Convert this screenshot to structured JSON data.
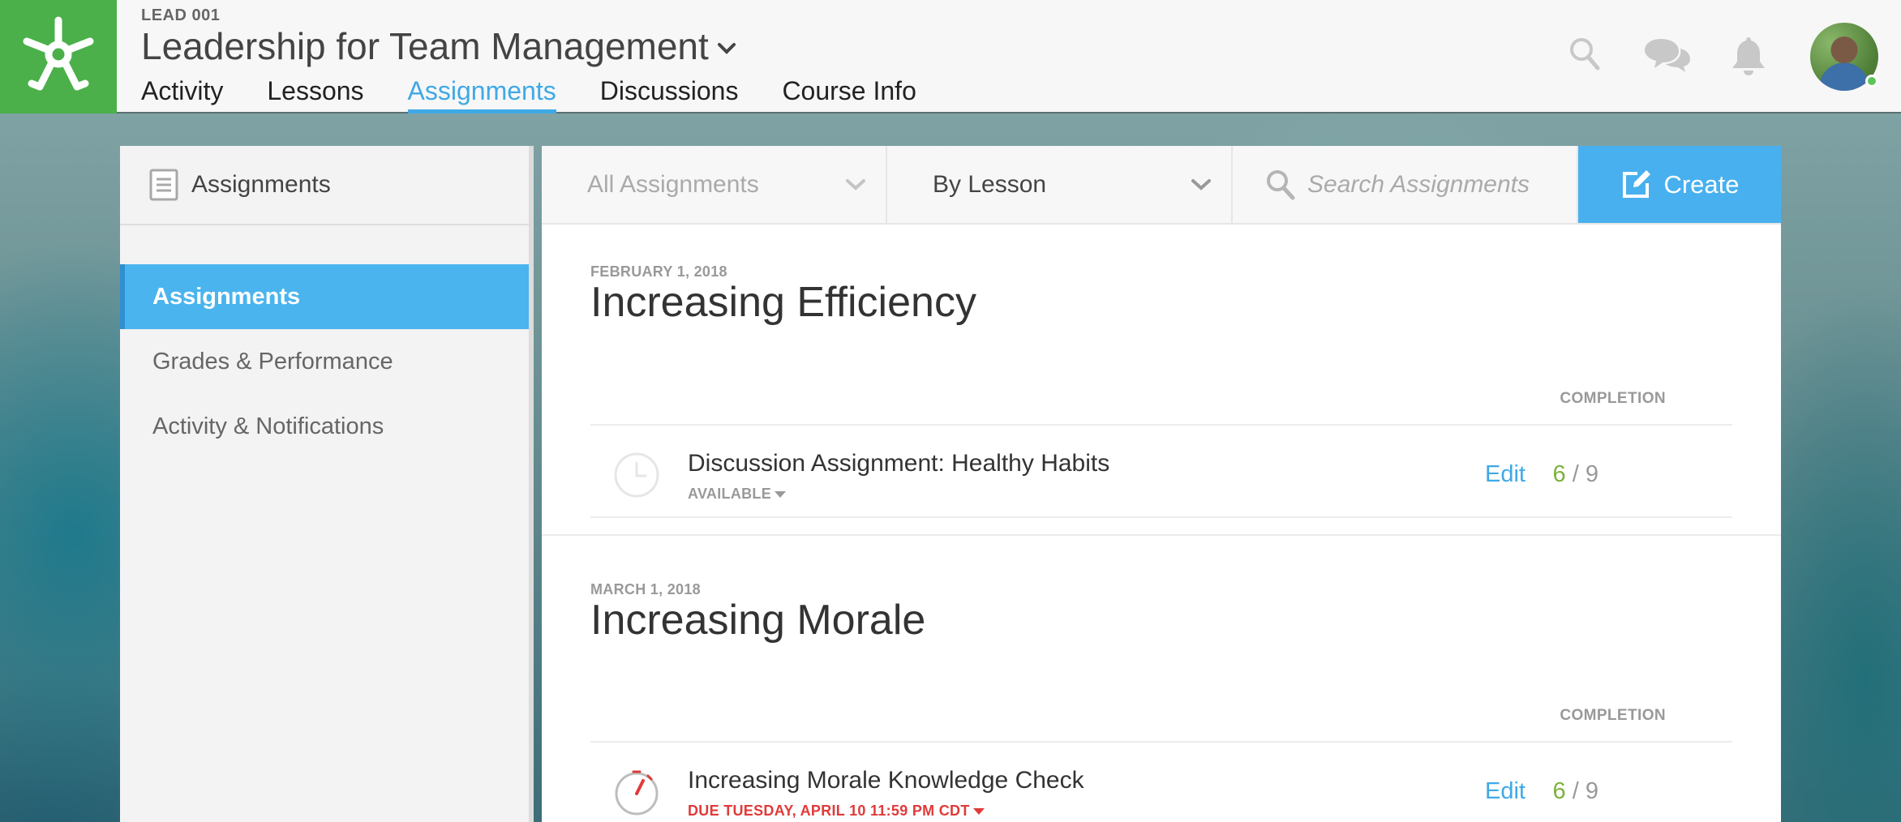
{
  "header": {
    "course_code": "LEAD 001",
    "course_title": "Leadership for Team Management",
    "tabs": [
      {
        "label": "Activity"
      },
      {
        "label": "Lessons"
      },
      {
        "label": "Assignments",
        "active": true
      },
      {
        "label": "Discussions"
      },
      {
        "label": "Course Info"
      }
    ],
    "icons": [
      "search-icon",
      "chat-icon",
      "bell-icon"
    ],
    "avatar_status": "online"
  },
  "sidebar": {
    "title": "Assignments",
    "items": [
      {
        "label": "Assignments",
        "active": true
      },
      {
        "label": "Grades & Performance"
      },
      {
        "label": "Activity & Notifications"
      }
    ]
  },
  "toolbar": {
    "filter_value": "All Assignments",
    "group_value": "By Lesson",
    "search_placeholder": "Search Assignments",
    "create_label": "Create"
  },
  "sections": [
    {
      "date": "FEBRUARY 1, 2018",
      "title": "Increasing Efficiency",
      "completion_label": "COMPLETION",
      "assignments": [
        {
          "name": "Discussion Assignment: Healthy Habits",
          "status": "AVAILABLE",
          "icon": "clock-icon",
          "edit_label": "Edit",
          "completed": "6",
          "separator": "/",
          "total": "9"
        }
      ]
    },
    {
      "date": "MARCH 1, 2018",
      "title": "Increasing Morale",
      "completion_label": "COMPLETION",
      "assignments": [
        {
          "name": "Increasing Morale Knowledge Check",
          "status": "DUE TUESDAY, APRIL 10 11:59 PM CDT",
          "icon": "timer-icon",
          "edit_label": "Edit",
          "completed": "6",
          "separator": "/",
          "total": "9"
        }
      ]
    }
  ],
  "colors": {
    "brand_green": "#4bb04a",
    "accent_blue": "#48b0ee",
    "completion_green": "#7bb23a",
    "due_red": "#e03a3a"
  }
}
